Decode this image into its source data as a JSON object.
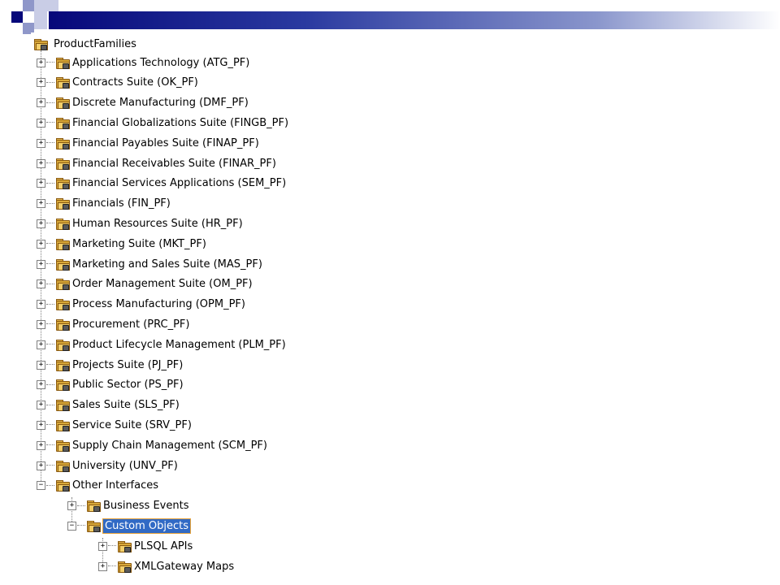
{
  "tree": {
    "root": {
      "label": "ProductFamilies",
      "icon": "product-families-icon"
    },
    "items": [
      {
        "label": "Applications Technology (ATG_PF)",
        "expander": "+"
      },
      {
        "label": "Contracts Suite (OK_PF)",
        "expander": "+"
      },
      {
        "label": "Discrete Manufacturing (DMF_PF)",
        "expander": "+"
      },
      {
        "label": "Financial Globalizations Suite (FINGB_PF)",
        "expander": "+"
      },
      {
        "label": "Financial Payables Suite (FINAP_PF)",
        "expander": "+"
      },
      {
        "label": "Financial Receivables Suite (FINAR_PF)",
        "expander": "+"
      },
      {
        "label": "Financial Services Applications (SEM_PF)",
        "expander": "+"
      },
      {
        "label": "Financials (FIN_PF)",
        "expander": "+"
      },
      {
        "label": "Human Resources Suite (HR_PF)",
        "expander": "+"
      },
      {
        "label": "Marketing Suite (MKT_PF)",
        "expander": "+"
      },
      {
        "label": "Marketing and Sales Suite (MAS_PF)",
        "expander": "+"
      },
      {
        "label": "Order Management Suite (OM_PF)",
        "expander": "+"
      },
      {
        "label": "Process Manufacturing (OPM_PF)",
        "expander": "+"
      },
      {
        "label": "Procurement (PRC_PF)",
        "expander": "+"
      },
      {
        "label": "Product Lifecycle Management (PLM_PF)",
        "expander": "+"
      },
      {
        "label": "Projects Suite (PJ_PF)",
        "expander": "+"
      },
      {
        "label": "Public Sector (PS_PF)",
        "expander": "+"
      },
      {
        "label": "Sales Suite (SLS_PF)",
        "expander": "+"
      },
      {
        "label": "Service Suite (SRV_PF)",
        "expander": "+"
      },
      {
        "label": "Supply Chain Management (SCM_PF)",
        "expander": "+"
      },
      {
        "label": "University (UNV_PF)",
        "expander": "+"
      },
      {
        "label": "Other Interfaces",
        "expander": "−"
      }
    ],
    "other_interfaces": [
      {
        "label": "Business Events",
        "expander": "+"
      },
      {
        "label": "Custom Objects",
        "expander": "−",
        "selected": true
      }
    ],
    "custom_objects": [
      {
        "label": "PLSQL APIs",
        "expander": "+"
      },
      {
        "label": "XMLGateway Maps",
        "expander": "+"
      }
    ]
  },
  "colors": {
    "header_bar": "#06087a",
    "selection": "#316ac5",
    "selection_outline": "#e6a23a",
    "folder": "#f3cf6b"
  }
}
